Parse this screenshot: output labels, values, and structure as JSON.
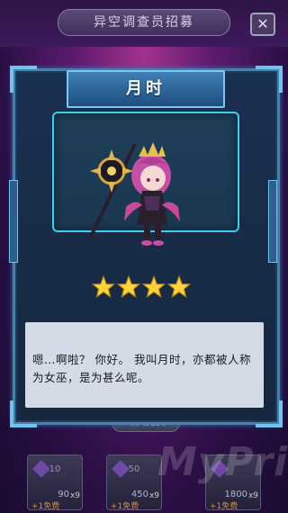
{
  "header": {
    "title": "异空调查员招募",
    "close_icon": "close-icon"
  },
  "character": {
    "name": "月时",
    "stars": 4,
    "dialog": "嗯…啊啦？ 你好。 我叫月时，亦都被人称为女巫，是为甚么呢。"
  },
  "bottom": {
    "daily_label": "每天免费",
    "cards": [
      {
        "cost": "10",
        "price": "90",
        "multiplier": "x9",
        "free": "+1免费"
      },
      {
        "cost": "50",
        "price": "450",
        "multiplier": "x9",
        "free": "+1免费"
      },
      {
        "cost": "",
        "price": "1800",
        "multiplier": "x9",
        "free": "+1免费"
      }
    ]
  },
  "watermark": "MyPrice",
  "colors": {
    "star": "#ffd23a",
    "frame": "#4a7fa6",
    "banner": "#2f6da6",
    "background": "#5a1b6d"
  }
}
